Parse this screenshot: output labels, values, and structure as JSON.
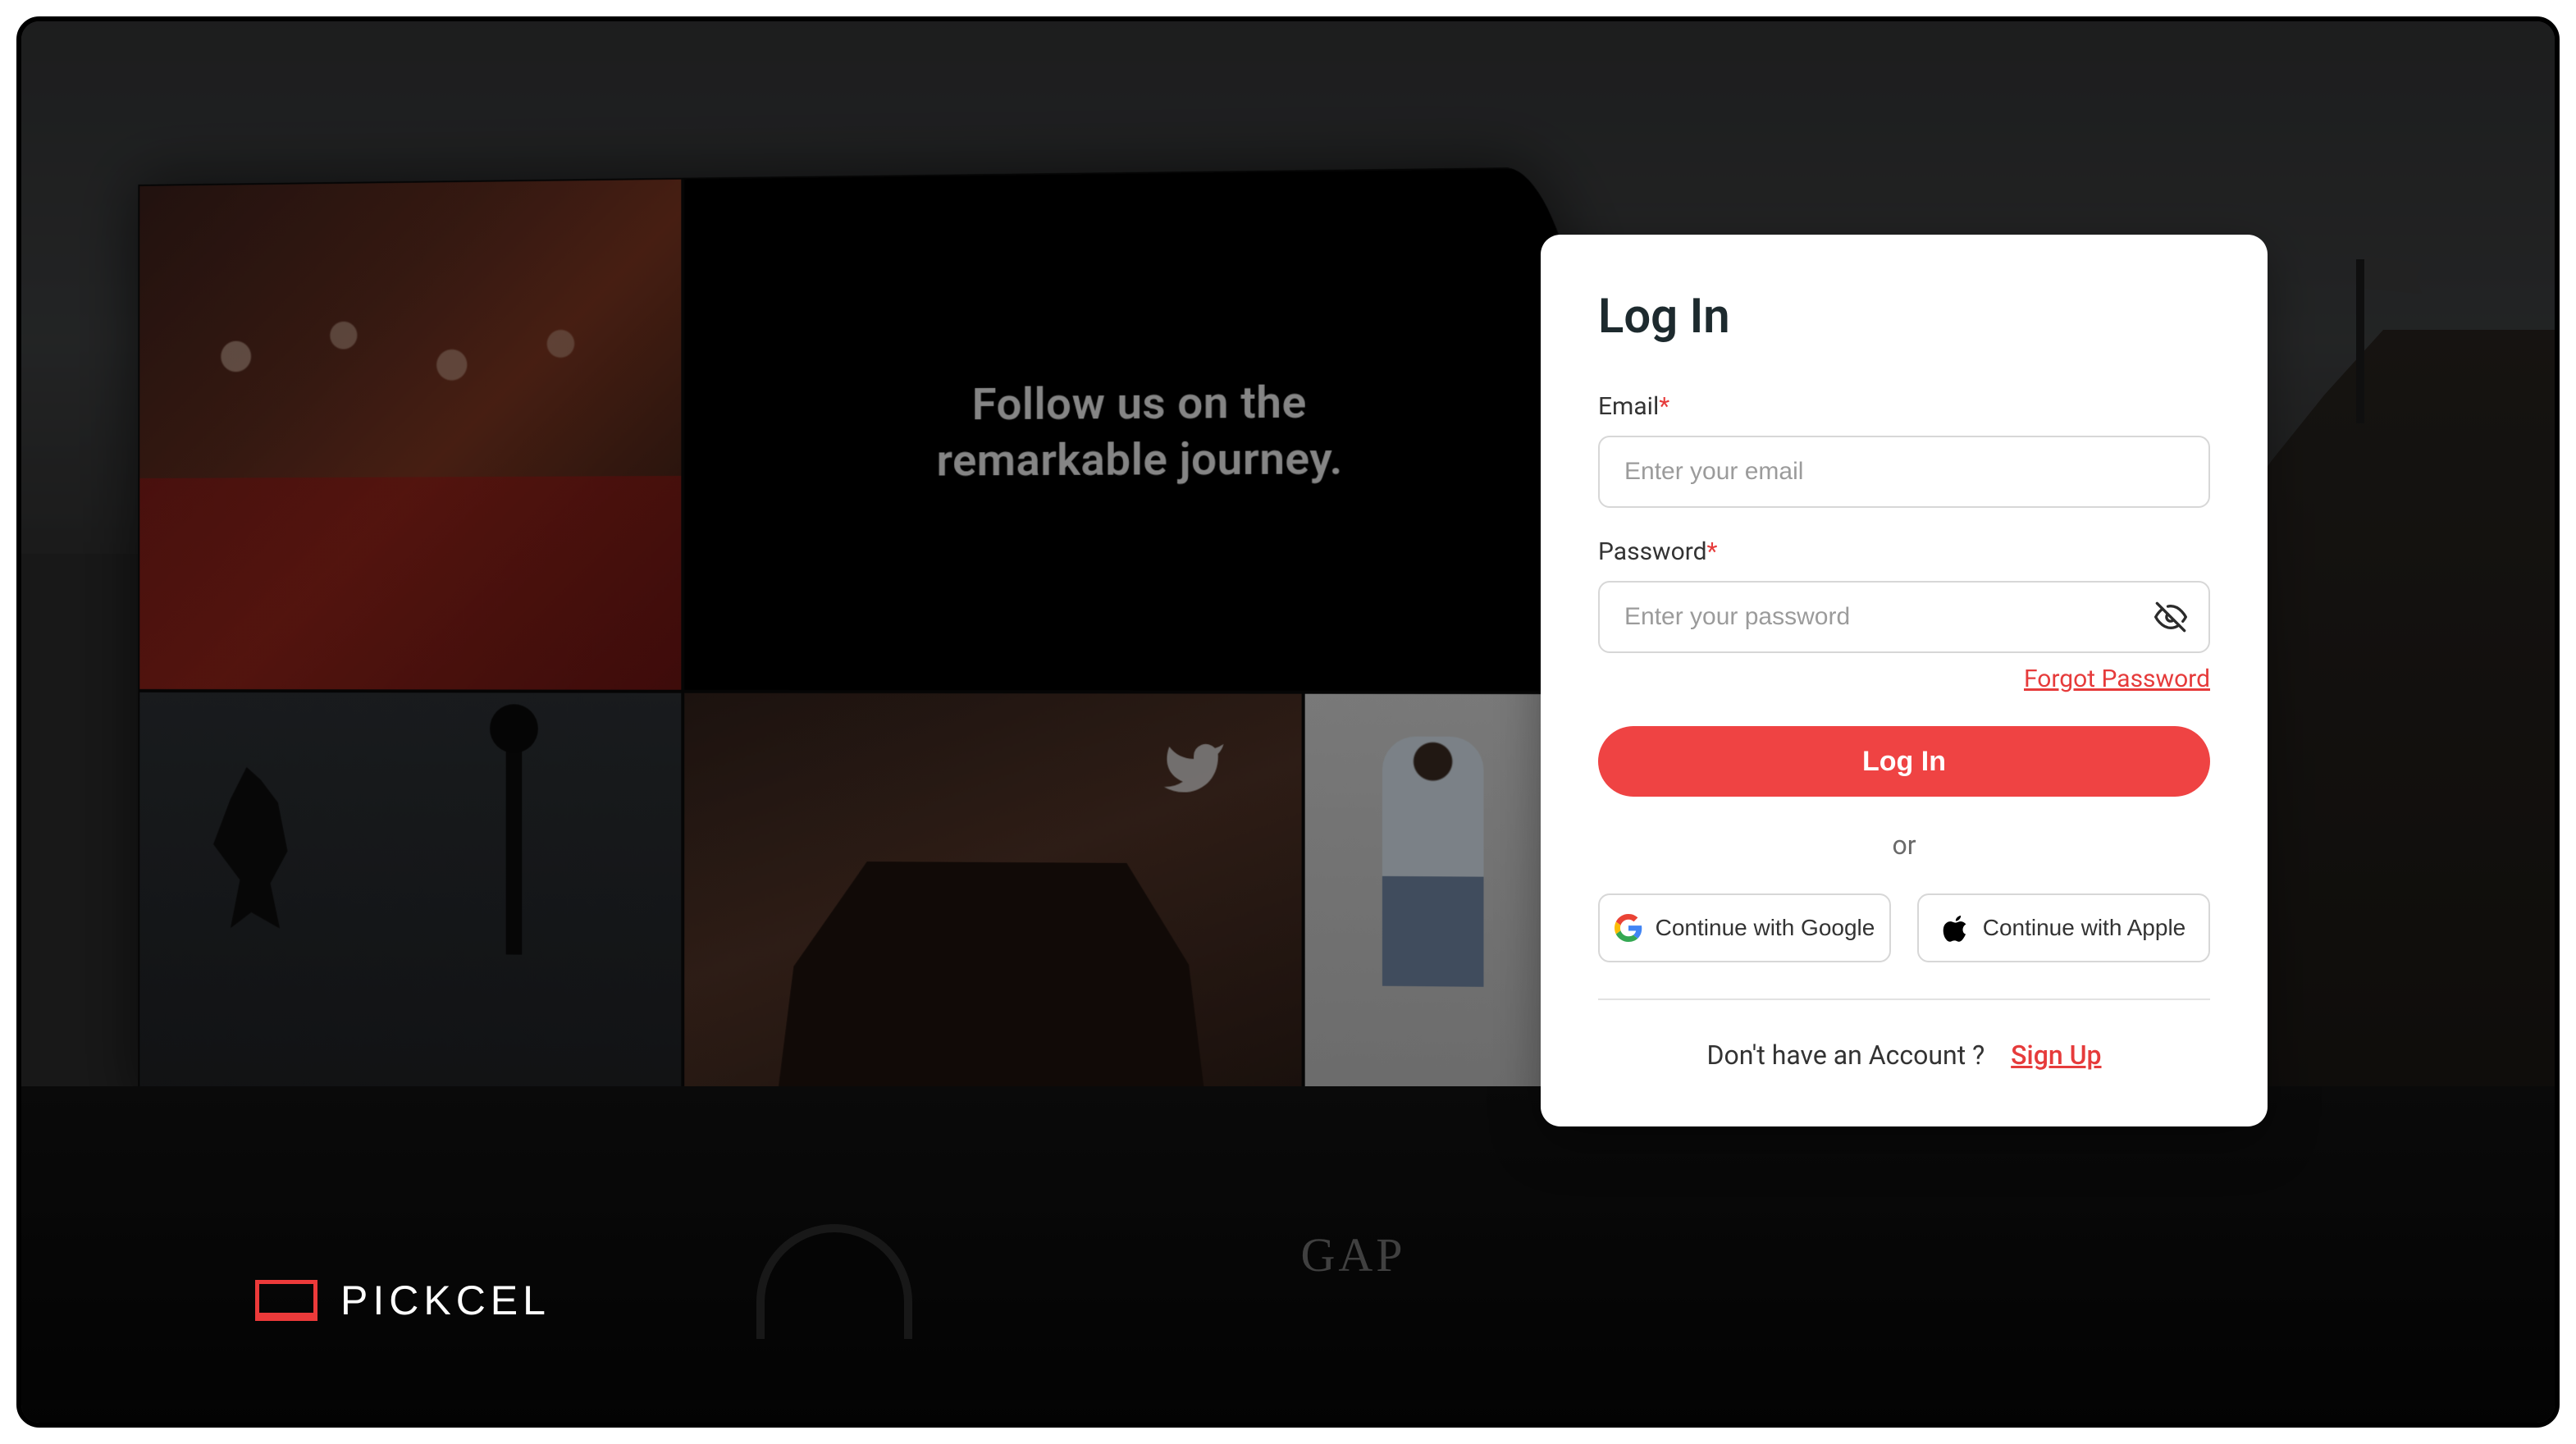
{
  "brand": {
    "name": "PICKCEL"
  },
  "background": {
    "billboard_headline": "Follow us on the\nremarkable journey.",
    "store_sign": "GAP"
  },
  "login": {
    "title": "Log In",
    "email_label": "Email",
    "email_placeholder": "Enter your email",
    "password_label": "Password",
    "password_placeholder": "Enter your password",
    "required_mark": "*",
    "forgot_link": "Forgot Password",
    "submit_label": "Log In",
    "or_label": "or",
    "google_label": "Continue with Google",
    "apple_label": "Continue with Apple",
    "no_account_text": "Don't have an Account ?",
    "signup_link": "Sign Up"
  }
}
